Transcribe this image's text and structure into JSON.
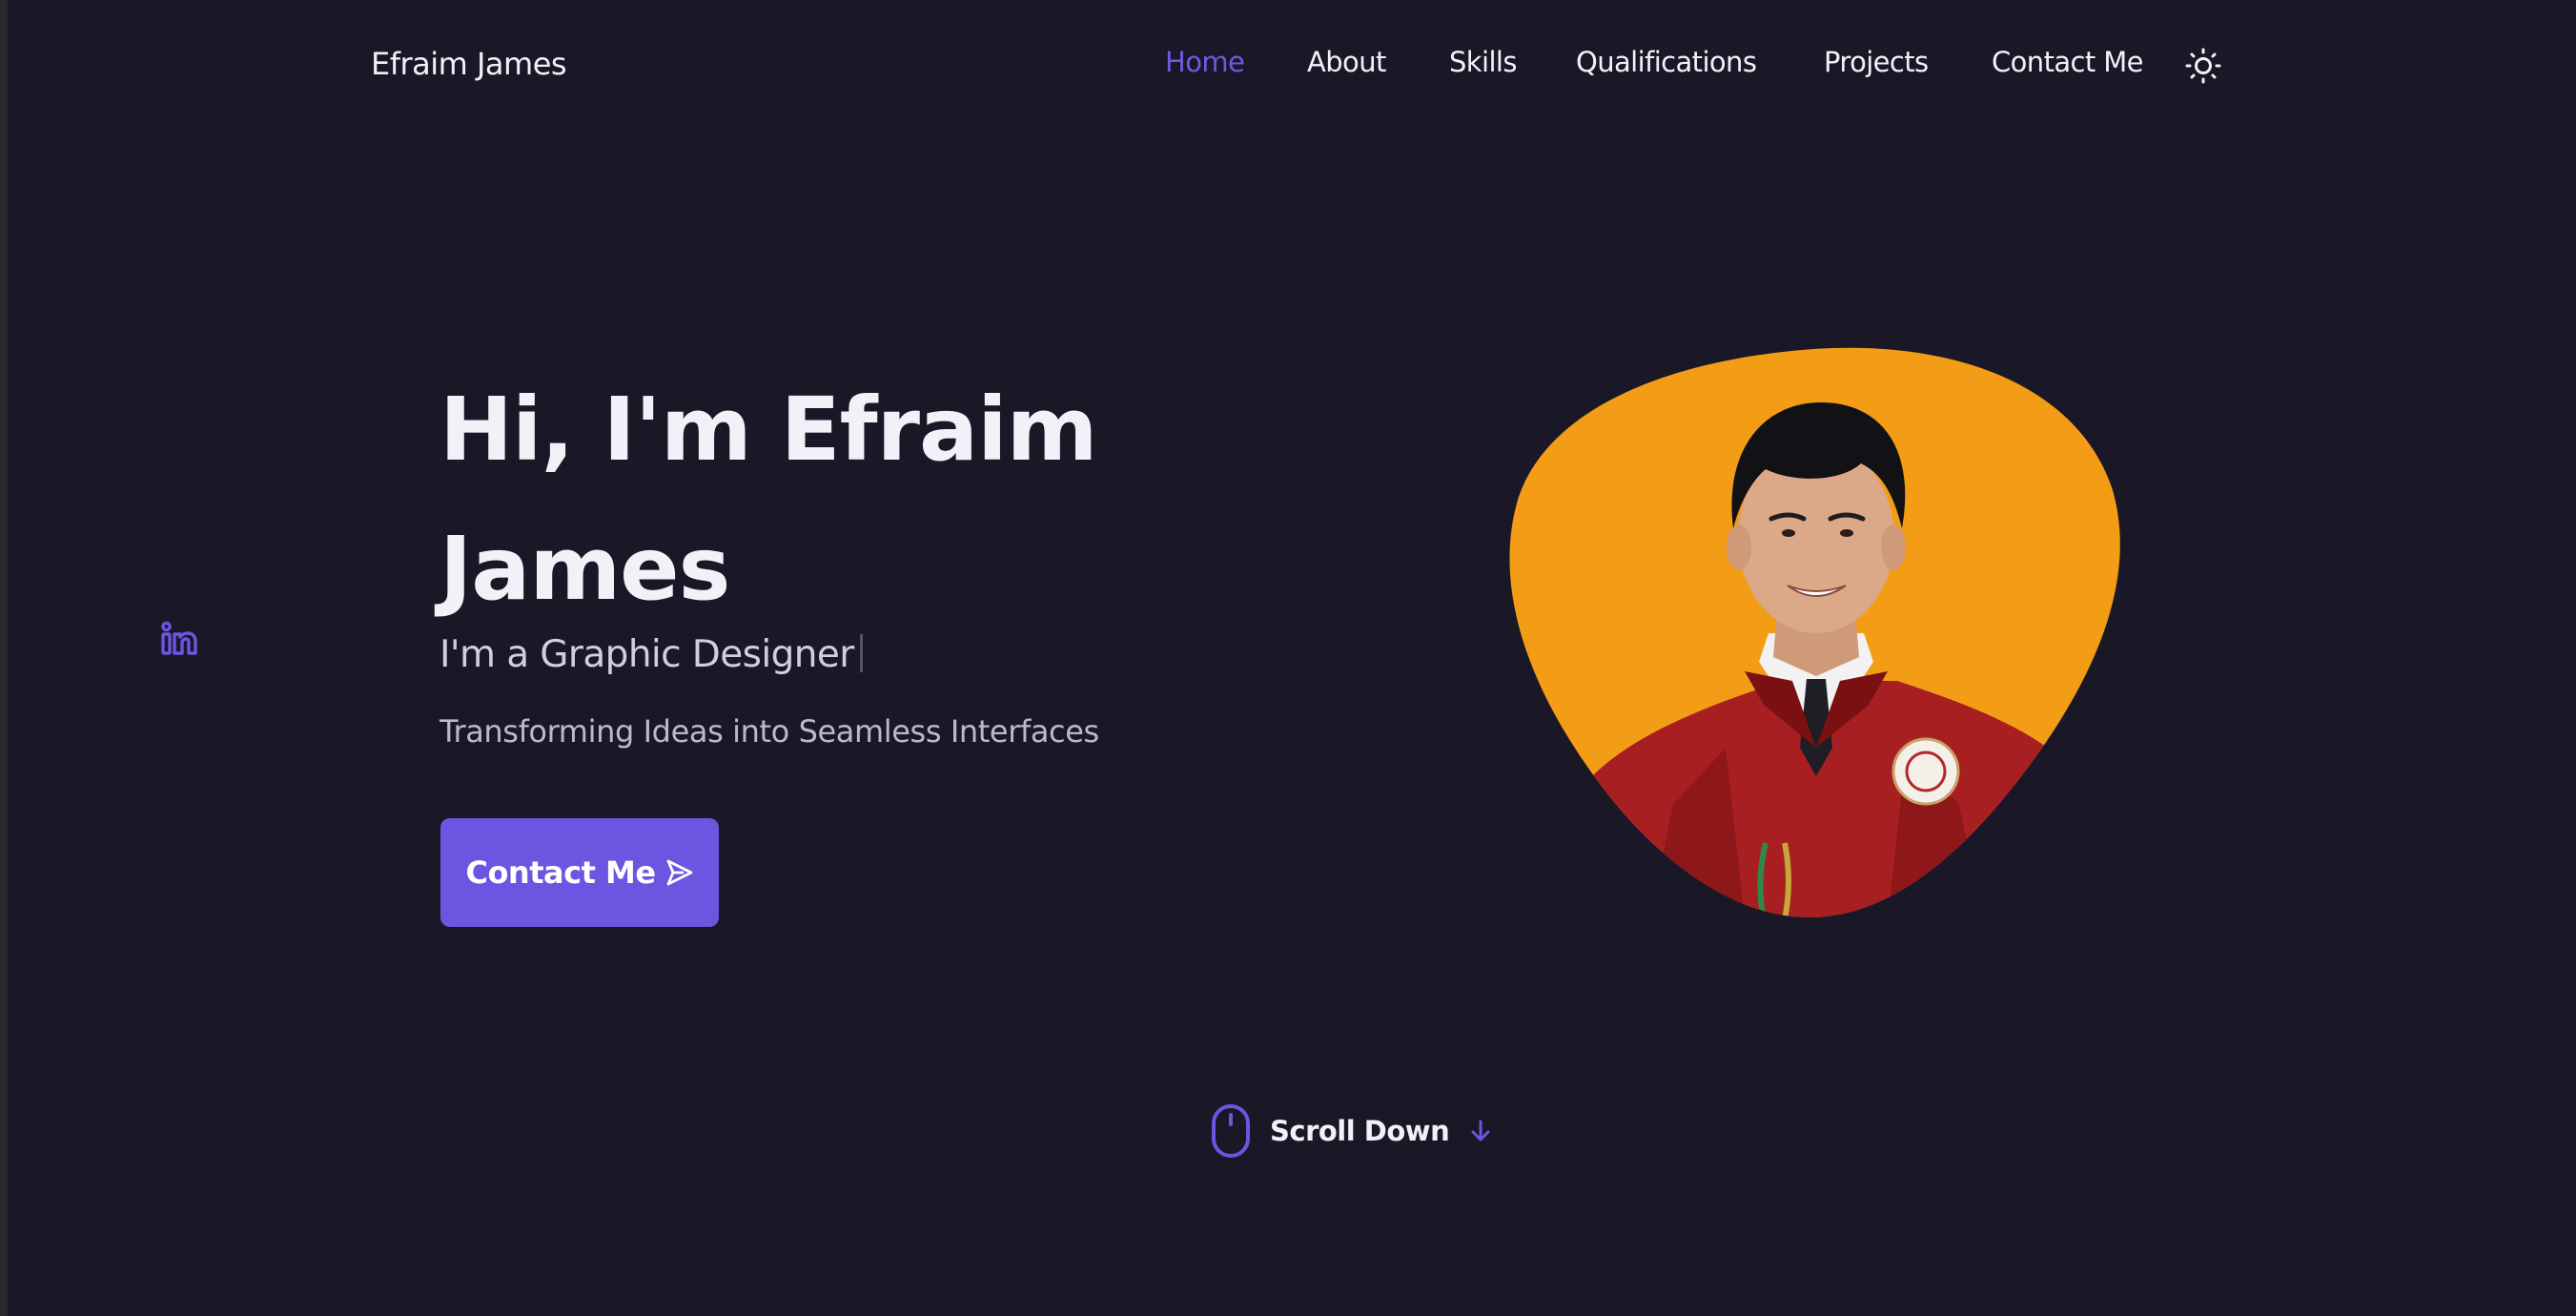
{
  "header": {
    "logo": "Efraim James",
    "nav": [
      {
        "label": "Home",
        "active": true
      },
      {
        "label": "About",
        "active": false
      },
      {
        "label": "Skills",
        "active": false
      },
      {
        "label": "Qualifications",
        "active": false
      },
      {
        "label": "Projects",
        "active": false
      },
      {
        "label": "Contact Me",
        "active": false
      }
    ],
    "theme_icon": "sun-icon"
  },
  "social": {
    "icon": "linkedin-icon"
  },
  "hero": {
    "title_line1": "Hi, I'm Efraim",
    "title_line2": "James",
    "subtitle": "I'm a Graphic Designer",
    "description": "Transforming Ideas into Seamless Interfaces",
    "button_label": "Contact Me",
    "button_icon": "send-icon",
    "image": "portrait-photo"
  },
  "scroll": {
    "label": "Scroll Down",
    "mouse_icon": "mouse-icon",
    "arrow_icon": "arrow-down-icon"
  },
  "colors": {
    "background": "#1a1726",
    "accent": "#6c55e0",
    "nav_active": "#7158e2",
    "text": "#f3f1f8",
    "blob": "#f39c16"
  }
}
